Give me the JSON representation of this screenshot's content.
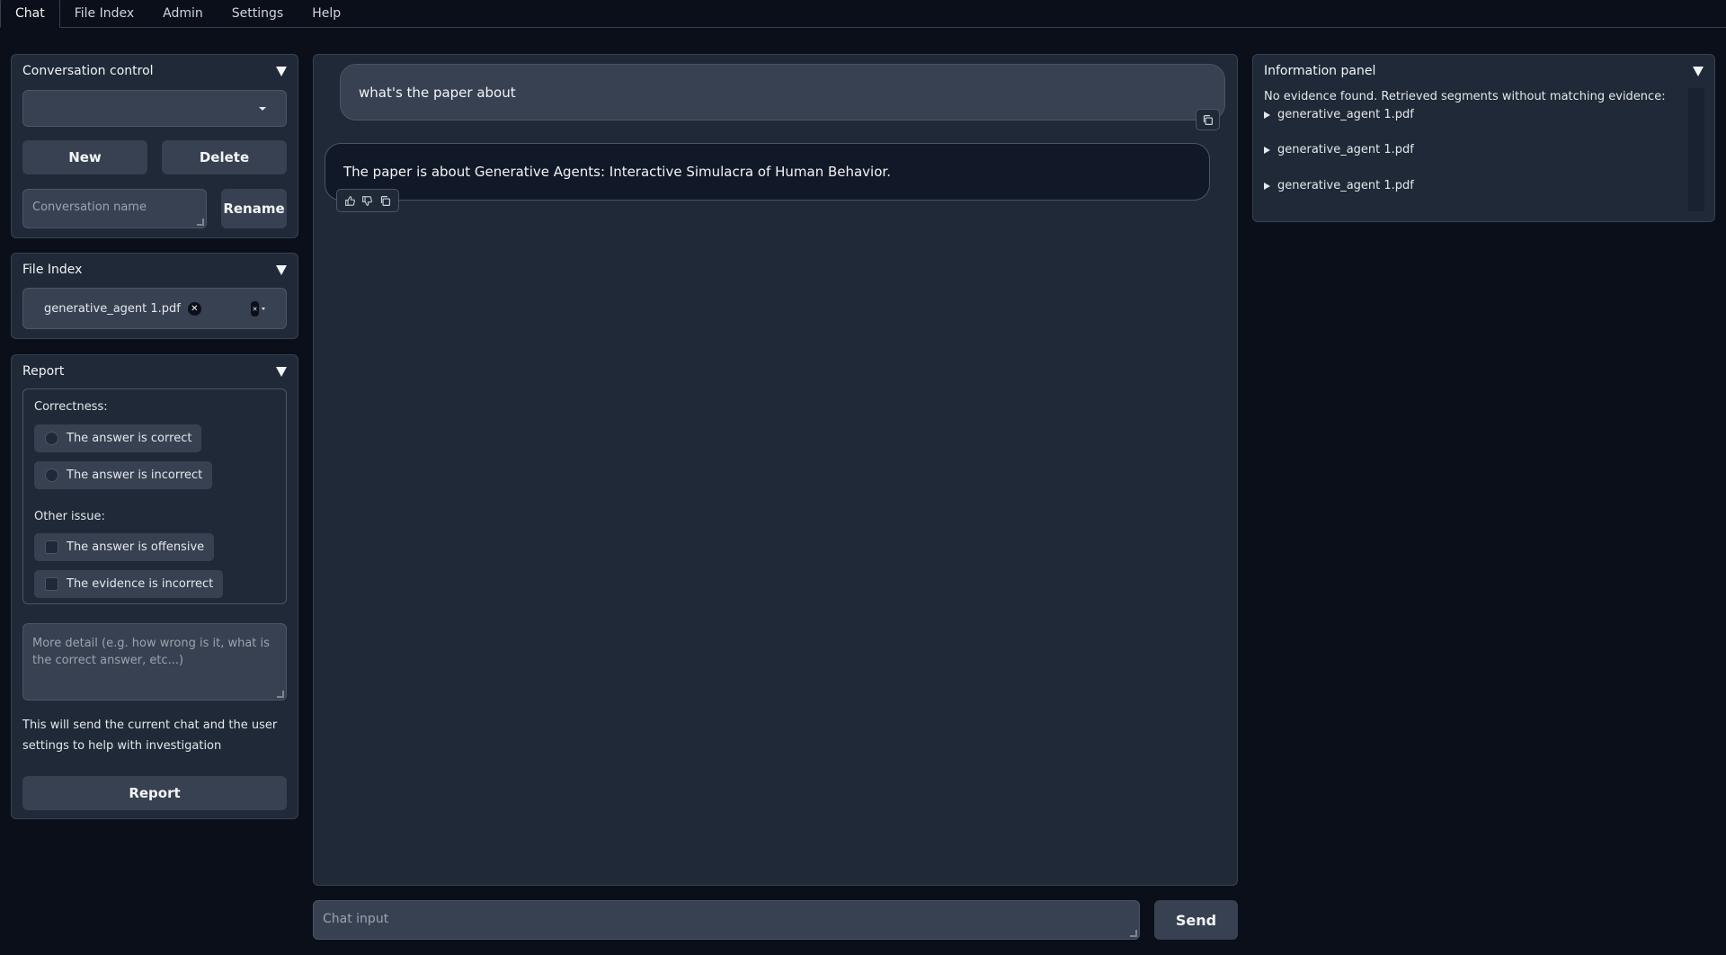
{
  "tabs": [
    {
      "label": "Chat",
      "active": true
    },
    {
      "label": "File Index",
      "active": false
    },
    {
      "label": "Admin",
      "active": false
    },
    {
      "label": "Settings",
      "active": false
    },
    {
      "label": "Help",
      "active": false
    }
  ],
  "conversation_control": {
    "title": "Conversation control",
    "selected": "",
    "new_label": "New",
    "delete_label": "Delete",
    "name_placeholder": "Conversation name",
    "rename_label": "Rename"
  },
  "file_index": {
    "title": "File Index",
    "selected_file": "generative_agent 1.pdf"
  },
  "report": {
    "title": "Report",
    "correctness_label": "Correctness:",
    "correct_option": "The answer is correct",
    "incorrect_option": "The answer is incorrect",
    "other_issue_label": "Other issue:",
    "offensive_option": "The answer is offensive",
    "evidence_option": "The evidence is incorrect",
    "detail_placeholder": "More detail (e.g. how wrong is it, what is the correct answer, etc...)",
    "note": "This will send the current chat and the user settings to help with investigation",
    "button_label": "Report"
  },
  "chat": {
    "user_message": "what's the paper about",
    "bot_message": "The paper is about Generative Agents: Interactive Simulacra of Human Behavior.",
    "input_placeholder": "Chat input",
    "send_label": "Send"
  },
  "info_panel": {
    "title": "Information panel",
    "message": "No evidence found. Retrieved segments without matching evidence:",
    "items": [
      "generative_agent 1.pdf",
      "generative_agent 1.pdf",
      "generative_agent 1.pdf"
    ]
  },
  "icons": {
    "collapse": "triangle-down-icon",
    "copy": "copy-icon",
    "like": "thumbs-up-icon",
    "dislike": "thumbs-down-icon",
    "remove": "close-icon",
    "expand": "triangle-right-icon"
  },
  "colors": {
    "background": "#0b0f19",
    "panel": "#1f2937",
    "control": "#374151",
    "border": "#4b5563"
  }
}
